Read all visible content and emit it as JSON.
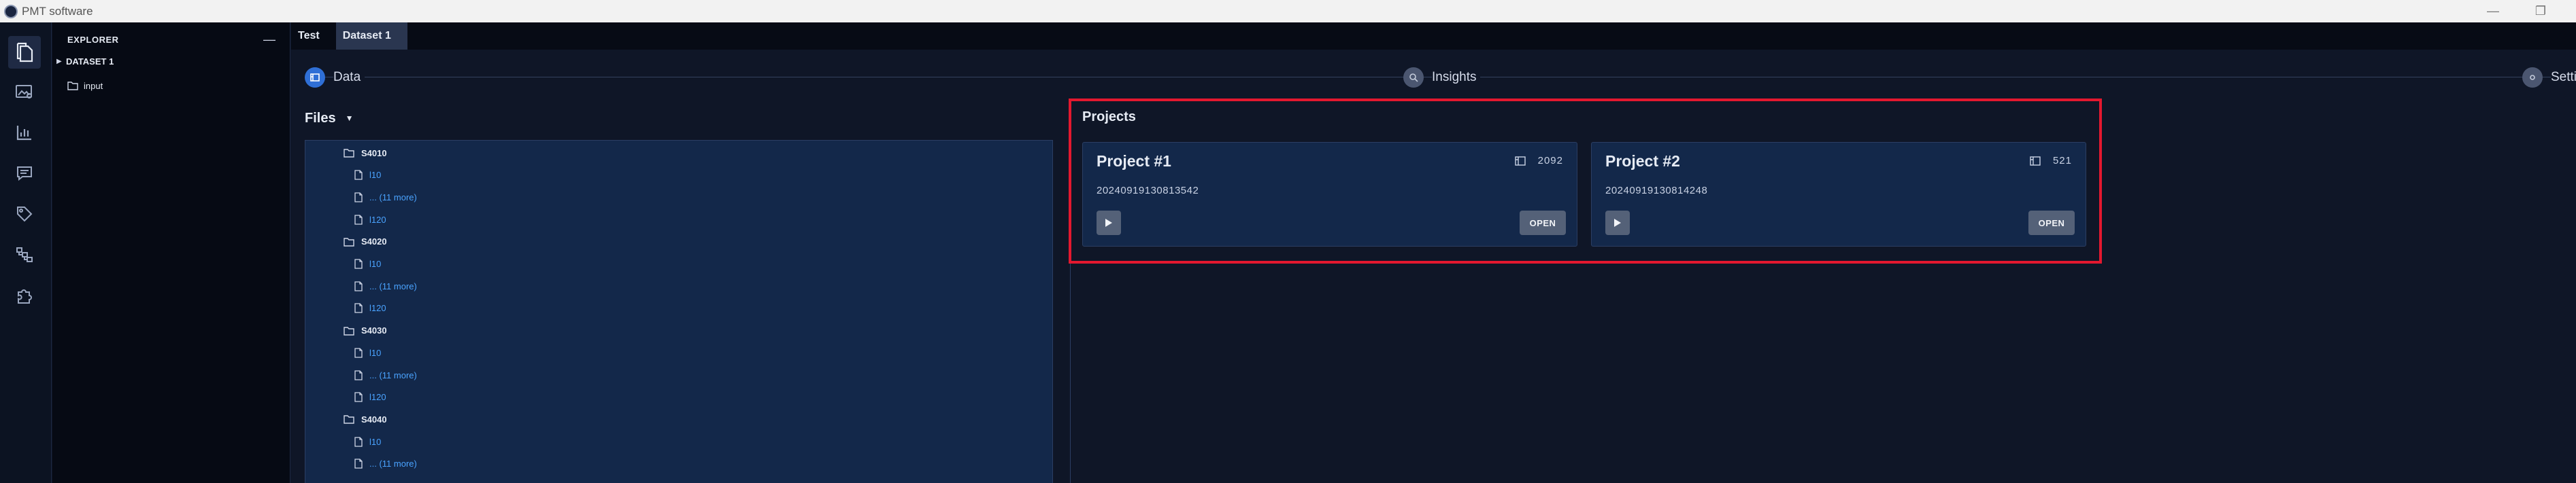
{
  "window": {
    "title": "PMT software"
  },
  "explorer": {
    "header": "EXPLORER",
    "collapse_label": "—",
    "dataset": "DATASET 1",
    "folder": "input"
  },
  "tabs": [
    {
      "label": "Test",
      "active": false
    },
    {
      "label": "Dataset 1",
      "active": true
    }
  ],
  "stepper": [
    {
      "label": "Data",
      "state": "active"
    },
    {
      "label": "Insights",
      "state": "inactive"
    },
    {
      "label": "Setti",
      "state": "inactive"
    }
  ],
  "files": {
    "title": "Files",
    "tree": [
      {
        "type": "folder",
        "label": "S4010"
      },
      {
        "type": "file",
        "label": "l10"
      },
      {
        "type": "file",
        "label": "...  (11 more)"
      },
      {
        "type": "file",
        "label": "l120"
      },
      {
        "type": "folder",
        "label": "S4020"
      },
      {
        "type": "file",
        "label": "l10"
      },
      {
        "type": "file",
        "label": "...  (11 more)"
      },
      {
        "type": "file",
        "label": "l120"
      },
      {
        "type": "folder",
        "label": "S4030"
      },
      {
        "type": "file",
        "label": "l10"
      },
      {
        "type": "file",
        "label": "...  (11 more)"
      },
      {
        "type": "file",
        "label": "l120"
      },
      {
        "type": "folder",
        "label": "S4040"
      },
      {
        "type": "file",
        "label": "l10"
      },
      {
        "type": "file",
        "label": "...  (11 more)"
      }
    ]
  },
  "projects": {
    "title": "Projects",
    "items": [
      {
        "name": "Project #1",
        "count": "2092",
        "timestamp": "20240919130813542",
        "open_label": "OPEN"
      },
      {
        "name": "Project #2",
        "count": "521",
        "timestamp": "20240919130814248",
        "open_label": "OPEN"
      }
    ]
  },
  "colors": {
    "accent": "#2f6fd6",
    "highlight_border": "#e3182f",
    "link": "#4aa3ff",
    "panel": "#13284a"
  }
}
